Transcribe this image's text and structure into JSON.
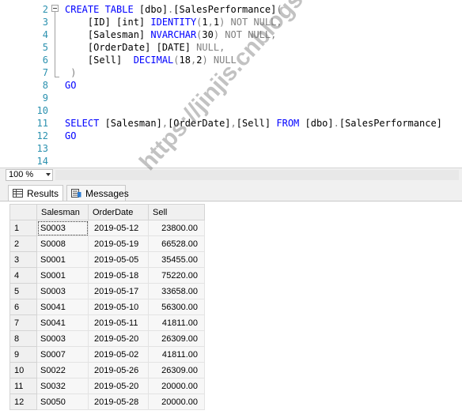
{
  "editor": {
    "line_numbers": [
      "2",
      "3",
      "4",
      "5",
      "6",
      "7",
      "8",
      "9",
      "10",
      "11",
      "12",
      "13",
      "14"
    ],
    "lines": [
      [
        {
          "t": "CREATE TABLE ",
          "c": "kw"
        },
        {
          "t": "[dbo]",
          "c": ""
        },
        {
          "t": ".",
          "c": "gr"
        },
        {
          "t": "[SalesPerformance]",
          "c": ""
        },
        {
          "t": "(",
          "c": "gr"
        }
      ],
      [
        {
          "t": "    [ID] [int] ",
          "c": ""
        },
        {
          "t": "IDENTITY",
          "c": "kw"
        },
        {
          "t": "(",
          "c": "gr"
        },
        {
          "t": "1",
          "c": ""
        },
        {
          "t": ",",
          "c": "gr"
        },
        {
          "t": "1",
          "c": ""
        },
        {
          "t": ") NOT NULL,",
          "c": "gr"
        }
      ],
      [
        {
          "t": "    [Salesman] ",
          "c": ""
        },
        {
          "t": "NVARCHAR",
          "c": "kw"
        },
        {
          "t": "(",
          "c": "gr"
        },
        {
          "t": "30",
          "c": ""
        },
        {
          "t": ") NOT NULL,",
          "c": "gr"
        }
      ],
      [
        {
          "t": "    [OrderDate] ",
          "c": ""
        },
        {
          "t": "[DATE]",
          "c": ""
        },
        {
          "t": " NULL,",
          "c": "gr"
        }
      ],
      [
        {
          "t": "    [Sell]  ",
          "c": ""
        },
        {
          "t": "DECIMAL",
          "c": "kw"
        },
        {
          "t": "(",
          "c": "gr"
        },
        {
          "t": "18",
          "c": ""
        },
        {
          "t": ",",
          "c": "gr"
        },
        {
          "t": "2",
          "c": ""
        },
        {
          "t": ") NULL",
          "c": "gr"
        }
      ],
      [
        {
          "t": " )",
          "c": "gr"
        }
      ],
      [
        {
          "t": "GO",
          "c": "kw"
        }
      ],
      [
        {
          "t": "",
          "c": ""
        }
      ],
      [
        {
          "t": "",
          "c": ""
        }
      ],
      [
        {
          "t": "SELECT ",
          "c": "kw"
        },
        {
          "t": "[Salesman]",
          "c": ""
        },
        {
          "t": ",",
          "c": "gr"
        },
        {
          "t": "[OrderDate]",
          "c": ""
        },
        {
          "t": ",",
          "c": "gr"
        },
        {
          "t": "[Sell]",
          "c": ""
        },
        {
          "t": " FROM ",
          "c": "kw"
        },
        {
          "t": "[dbo]",
          "c": ""
        },
        {
          "t": ".",
          "c": "gr"
        },
        {
          "t": "[SalesPerformance]",
          "c": ""
        }
      ],
      [
        {
          "t": "GO",
          "c": "kw"
        }
      ],
      [
        {
          "t": "",
          "c": ""
        }
      ],
      [
        {
          "t": "",
          "c": ""
        }
      ]
    ]
  },
  "zoom": {
    "value": "100 %"
  },
  "tabs": {
    "results": "Results",
    "messages": "Messages"
  },
  "grid": {
    "columns": [
      "Salesman",
      "OrderDate",
      "Sell"
    ],
    "rows": [
      [
        "1",
        "S0003",
        "2019-05-12",
        "23800.00"
      ],
      [
        "2",
        "S0008",
        "2019-05-19",
        "66528.00"
      ],
      [
        "3",
        "S0001",
        "2019-05-05",
        "35455.00"
      ],
      [
        "4",
        "S0001",
        "2019-05-18",
        "75220.00"
      ],
      [
        "5",
        "S0003",
        "2019-05-17",
        "33658.00"
      ],
      [
        "6",
        "S0041",
        "2019-05-10",
        "56300.00"
      ],
      [
        "7",
        "S0041",
        "2019-05-11",
        "41811.00"
      ],
      [
        "8",
        "S0003",
        "2019-05-20",
        "26309.00"
      ],
      [
        "9",
        "S0007",
        "2019-05-02",
        "41811.00"
      ],
      [
        "10",
        "S0022",
        "2019-05-26",
        "26309.00"
      ],
      [
        "11",
        "S0032",
        "2019-05-20",
        "20000.00"
      ],
      [
        "12",
        "S0050",
        "2019-05-28",
        "20000.00"
      ]
    ]
  },
  "watermark": "https://jinjis.cnblogs.com",
  "colors": {
    "keyword": "#0000ff",
    "line_number": "#2b91af",
    "operator": "#808080"
  }
}
